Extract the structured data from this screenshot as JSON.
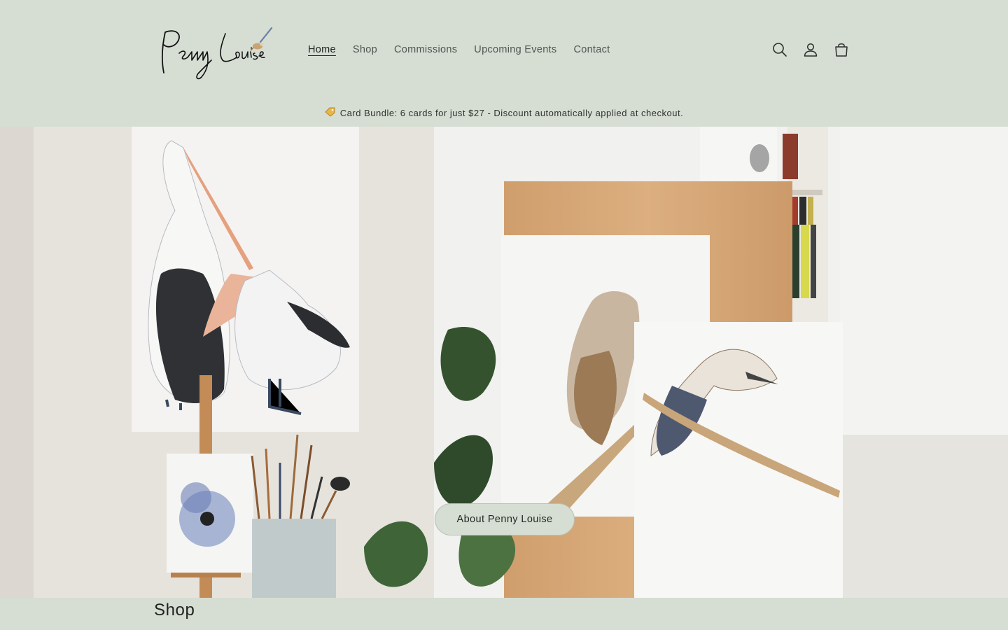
{
  "header": {
    "logo_text": "Penny Louise",
    "nav": [
      {
        "label": "Home",
        "active": true
      },
      {
        "label": "Shop",
        "active": false
      },
      {
        "label": "Commissions",
        "active": false
      },
      {
        "label": "Upcoming Events",
        "active": false
      },
      {
        "label": "Contact",
        "active": false
      }
    ],
    "icons": [
      "search-icon",
      "account-icon",
      "cart-icon"
    ]
  },
  "announcement": {
    "icon": "tag-icon",
    "text": "Card Bundle: 6 cards for just $27 - Discount automatically applied at checkout."
  },
  "hero": {
    "button_label": "About Penny Louise"
  },
  "sections": {
    "shop_heading": "Shop"
  },
  "colors": {
    "background": "#d6ddd3",
    "text": "#2c2f2c",
    "button_bg": "#d6ddd3"
  }
}
